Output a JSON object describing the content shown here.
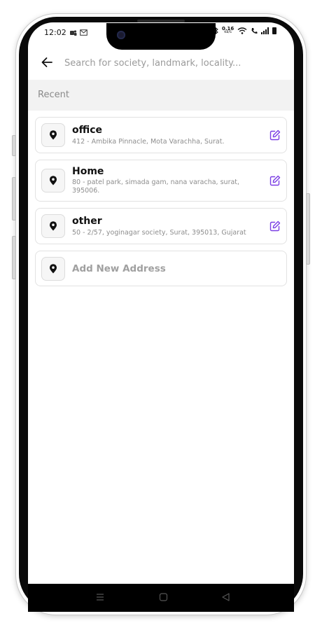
{
  "status_bar": {
    "time": "12:02",
    "speed_value": "0.16",
    "speed_unit": "KB/S"
  },
  "search": {
    "placeholder": "Search for society, landmark, locality..."
  },
  "section": {
    "label": "Recent"
  },
  "addresses": [
    {
      "title": "office",
      "subtitle": "412 - Ambika Pinnacle,   Mota Varachha,  Surat."
    },
    {
      "title": "Home",
      "subtitle": "80 - patel park, simada gam, nana varacha, surat, 395006."
    },
    {
      "title": "other",
      "subtitle": "50 - 2/57, yoginagar society, Surat, 395013, Gujarat"
    }
  ],
  "add_address": {
    "label": "Add New Address"
  },
  "colors": {
    "accent": "#7b3fe4",
    "section_bg": "#f2f2f2",
    "muted_text": "#8d8d8d"
  },
  "icons": [
    "back-arrow-icon",
    "location-pin-icon",
    "edit-icon",
    "nav-menu-icon",
    "nav-home-icon",
    "nav-back-icon"
  ]
}
